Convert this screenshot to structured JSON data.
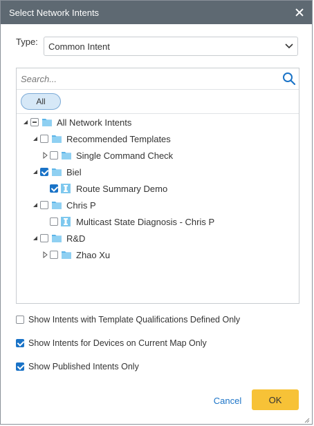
{
  "dialog": {
    "title": "Select Network Intents"
  },
  "type": {
    "label": "Type:",
    "value": "Common Intent"
  },
  "search": {
    "placeholder": "Search..."
  },
  "filter": {
    "chip_label": "All"
  },
  "tree": {
    "nodes": [
      {
        "label": "All Network Intents",
        "icon": "folder-icon",
        "expanded": true,
        "state": "partial"
      },
      {
        "label": "Recommended Templates",
        "icon": "folder-icon",
        "expanded": true,
        "state": "unchecked"
      },
      {
        "label": "Single Command Check",
        "icon": "folder-icon",
        "expanded": false,
        "state": "unchecked"
      },
      {
        "label": "Biel",
        "icon": "folder-icon",
        "expanded": true,
        "state": "checked"
      },
      {
        "label": "Route Summary Demo",
        "icon": "intent-icon",
        "state": "checked"
      },
      {
        "label": "Chris P",
        "icon": "folder-icon",
        "expanded": true,
        "state": "unchecked"
      },
      {
        "label": "Multicast State Diagnosis - Chris P",
        "icon": "intent-icon",
        "state": "unchecked"
      },
      {
        "label": "R&D",
        "icon": "folder-icon",
        "expanded": true,
        "state": "unchecked"
      },
      {
        "label": "Zhao Xu",
        "icon": "folder-icon",
        "expanded": false,
        "state": "unchecked"
      }
    ]
  },
  "options": [
    {
      "label": "Show Intents with Template Qualifications Defined Only",
      "checked": false
    },
    {
      "label": "Show Intents for Devices on Current Map Only",
      "checked": true
    },
    {
      "label": "Show Published Intents Only",
      "checked": true
    }
  ],
  "buttons": {
    "cancel": "Cancel",
    "ok": "OK"
  },
  "colors": {
    "titlebar": "#5e6972",
    "accent": "#1a73c7",
    "ok_button": "#f7c237",
    "folder": "#5bb4e8"
  }
}
